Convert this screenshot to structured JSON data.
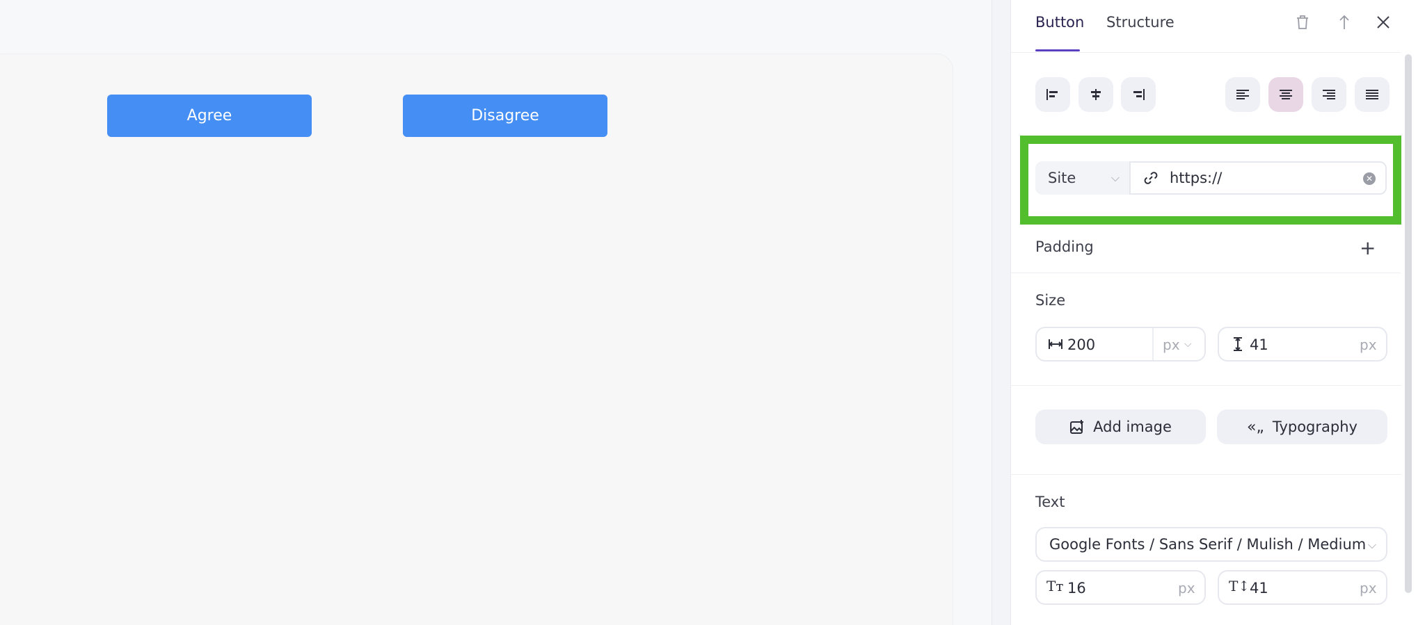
{
  "canvas": {
    "buttons": [
      {
        "label": "Agree"
      },
      {
        "label": "Disagree"
      }
    ],
    "button_color": "#448ef4"
  },
  "panel": {
    "tabs": [
      {
        "label": "Button",
        "active": true
      },
      {
        "label": "Structure",
        "active": false
      }
    ],
    "header_icons": [
      "trash-icon",
      "move-up-icon",
      "close-icon"
    ],
    "block_align": [
      "align-left-icon",
      "align-center-icon",
      "align-right-icon"
    ],
    "text_align": {
      "options": [
        "text-left-icon",
        "text-center-icon",
        "text-right-icon",
        "text-justify-icon"
      ],
      "selected": "text-center-icon"
    },
    "link": {
      "target_type": "Site",
      "url_value": "https://",
      "highlight_color": "#52be2e"
    },
    "padding": {
      "label": "Padding"
    },
    "size": {
      "label": "Size",
      "width_value": "200",
      "width_unit": "px",
      "height_value": "41",
      "height_unit": "px"
    },
    "actions": {
      "add_image": "Add image",
      "typography": "Typography"
    },
    "text": {
      "label": "Text",
      "font": "Google Fonts / Sans Serif / Mulish / Medium",
      "font_size_value": "16",
      "font_size_unit": "px",
      "line_height_value": "41",
      "line_height_unit": "px"
    }
  }
}
